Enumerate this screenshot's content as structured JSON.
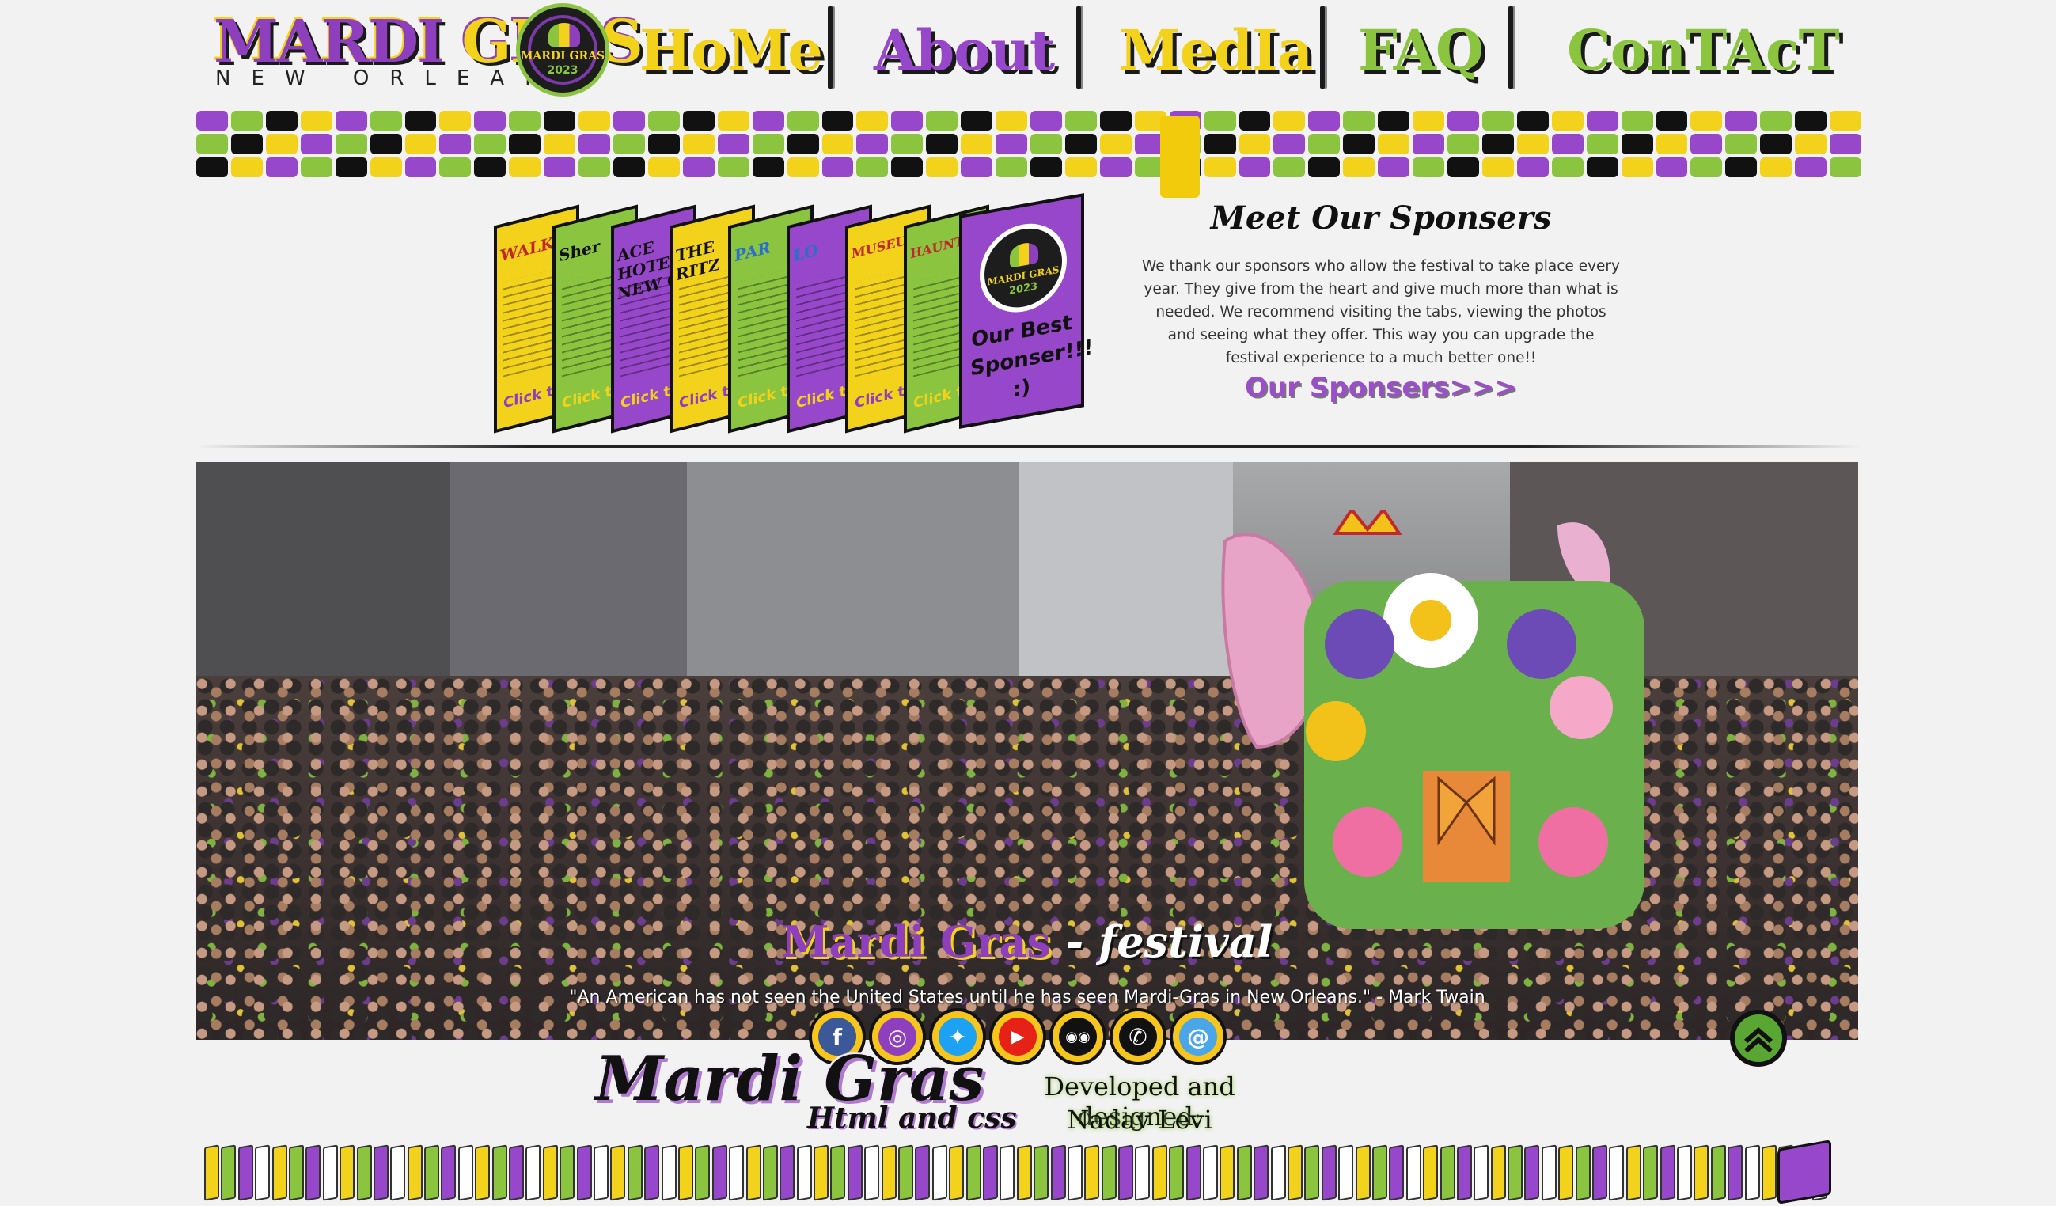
{
  "logo": {
    "title_part1": "MARDI",
    "title_part2": "GRAS",
    "subtitle": "NEW ORLEANS",
    "emblem_line1": "MARDI GRAS",
    "emblem_line2": "2023"
  },
  "nav": {
    "items": [
      {
        "label": "HoMe",
        "color": "#f2d21a"
      },
      {
        "label": "About",
        "color": "#9747c9"
      },
      {
        "label": "MedIa",
        "color": "#f2d21a"
      },
      {
        "label": "FAQ",
        "color": "#8bc53f"
      },
      {
        "label": "ConTAcT",
        "color": "#8bc53f"
      }
    ]
  },
  "sponsors": {
    "cards": [
      {
        "title": "WALK",
        "color": "#f2d21a",
        "click": "Click to"
      },
      {
        "title": "Sher",
        "color": "#8bc53f",
        "click": "Click to"
      },
      {
        "title": "ACE HOTEL NEW O",
        "color": "#9747c9",
        "click": "Click to"
      },
      {
        "title": "THE RITZ",
        "color": "#f2d21a",
        "click": "Click to"
      },
      {
        "title": "PAR",
        "color": "#8bc53f",
        "click": "Click to"
      },
      {
        "title": "LO",
        "color": "#9747c9",
        "click": "Click to"
      },
      {
        "title": "MUSEUM",
        "color": "#f2d21a",
        "click": "Click to"
      },
      {
        "title": "HAUNTED",
        "color": "#8bc53f",
        "click": "Click to"
      }
    ],
    "best_card_text": "Our Best Sponser!!! :)",
    "best_card_emblem_line1": "MARDI GRAS",
    "best_card_emblem_line2": "2023",
    "heading": "Meet Our Sponsers",
    "body": "We thank our sponsors who allow the festival to take place every year. They give from the heart and give much more than what is needed. We recommend visiting the tabs, viewing the photos and seeing what they offer. This way you can upgrade the festival experience to a much better one!!",
    "link": "Our Sponsers>>>"
  },
  "hero": {
    "title_part1": "Mardi Gras",
    "title_part2": "- festival",
    "quote": "\"An American has not seen the United States until he has seen Mardi-Gras in New Orleans.\" - Mark Twain"
  },
  "social": {
    "icons": [
      {
        "name": "facebook-icon",
        "glyph": "f",
        "color": "#3b5998"
      },
      {
        "name": "instagram-icon",
        "glyph": "◎",
        "color": "#8e3fbd"
      },
      {
        "name": "twitter-icon",
        "glyph": "✦",
        "color": "#1da1f2"
      },
      {
        "name": "youtube-icon",
        "glyph": "▶",
        "color": "#e62117"
      },
      {
        "name": "tripadvisor-icon",
        "glyph": "◉◉",
        "color": "#111111"
      },
      {
        "name": "phone-icon",
        "glyph": "✆",
        "color": "#111111"
      },
      {
        "name": "email-icon",
        "glyph": "@",
        "color": "#4aa6e8"
      }
    ]
  },
  "footer": {
    "title": "Mardi Gras",
    "subtitle": "Html and css",
    "developed_line1": "Developed and designed:",
    "developed_line2": "Nadav Levi"
  },
  "colors": {
    "purple": "#9747c9",
    "gold": "#f2d21a",
    "green": "#8bc53f",
    "black": "#111111"
  }
}
